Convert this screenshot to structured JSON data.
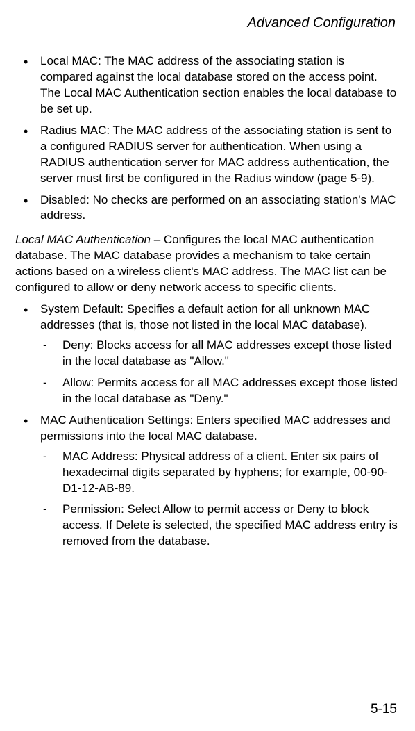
{
  "header": "Advanced Configuration",
  "top_bullets": [
    "Local MAC: The MAC address of the associating station is compared against the local database stored on the access point. The Local MAC Authentication section enables the local database to be set up.",
    "Radius MAC: The MAC address of the associating station is sent to a configured RADIUS server for authentication. When using a RADIUS authentication server for MAC address authentication, the server must first be configured in the Radius window (page 5-9).",
    "Disabled: No checks are performed on an associating station's MAC address."
  ],
  "section": {
    "lead_italic": "Local MAC Authentication",
    "lead_rest": " – Configures the local MAC authentication database. The MAC database provides a mechanism to take certain actions based on a wireless client's MAC address. The MAC list can be configured to allow or deny network access to specific clients."
  },
  "mid_bullets": [
    {
      "text": "System Default: Specifies a default action for all unknown MAC addresses (that is, those not listed in the local MAC database).",
      "sub": [
        "Deny: Blocks access for all MAC addresses except those listed in the local database as \"Allow.\"",
        "Allow: Permits access for all MAC addresses except those listed in the local database as \"Deny.\""
      ]
    },
    {
      "text": "MAC Authentication Settings: Enters specified MAC addresses and permissions into the local MAC database.",
      "sub": [
        "MAC Address: Physical address of a client. Enter six pairs of hexadecimal digits separated by hyphens; for example, 00-90-D1-12-AB-89.",
        "Permission: Select Allow to permit access or Deny to block access. If Delete is selected, the specified MAC address entry is removed from the database."
      ]
    }
  ],
  "page_number": "5-15"
}
